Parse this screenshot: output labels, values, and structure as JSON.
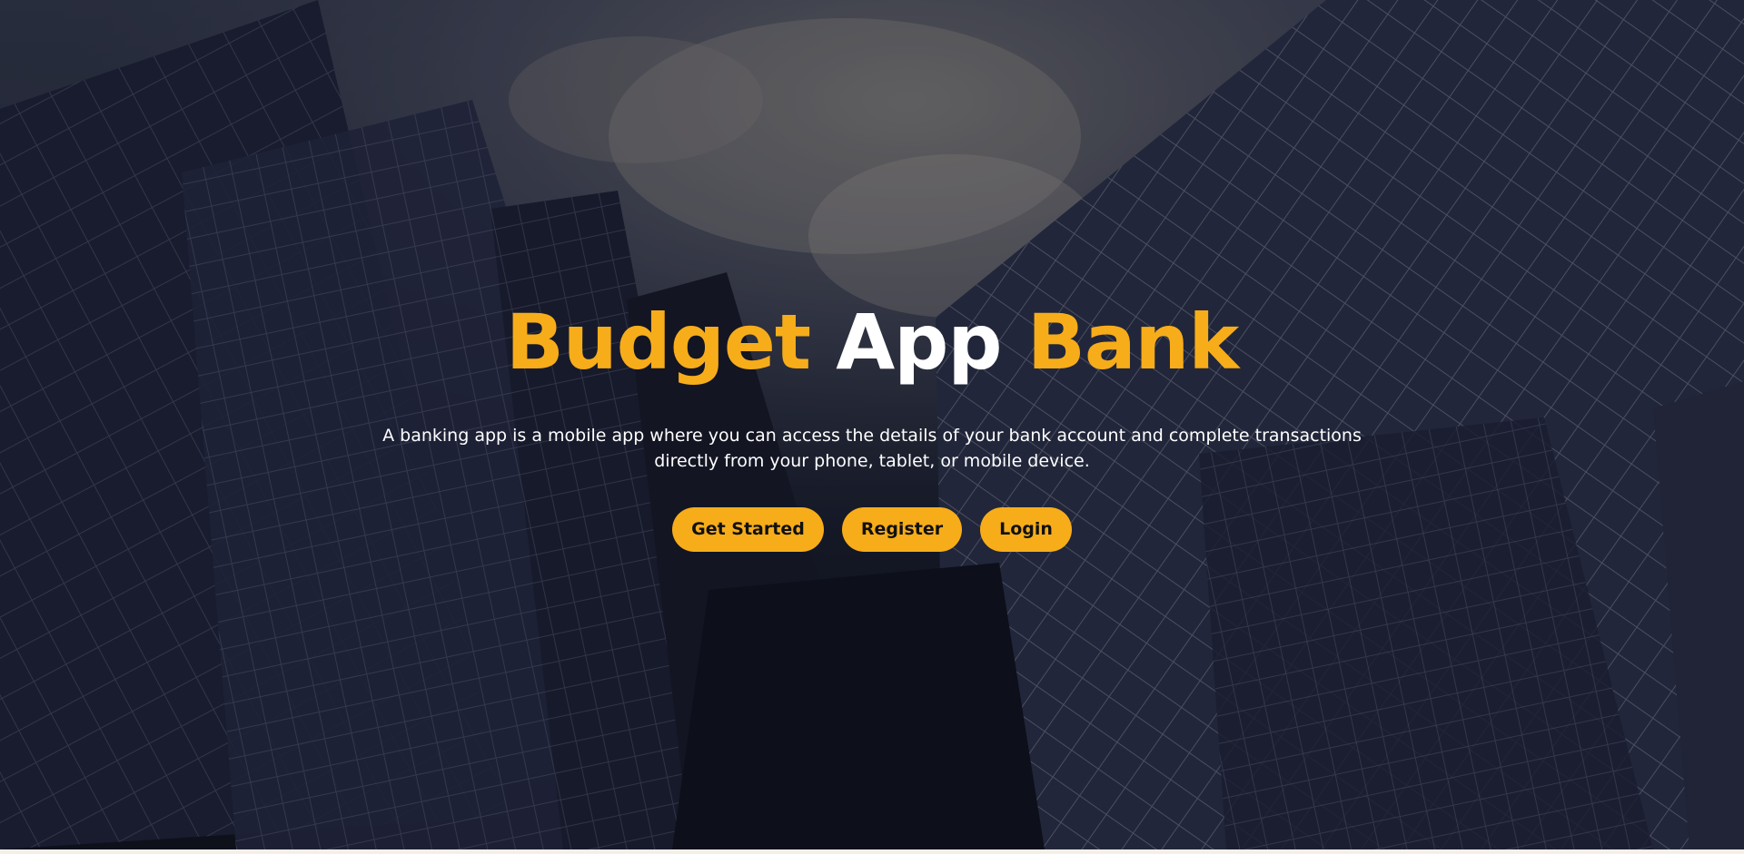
{
  "hero": {
    "title": {
      "word1": "Budget",
      "word2": "App",
      "word3": "Bank"
    },
    "description_line1": "A banking app is a mobile app where you can access the details of your bank account and complete transactions",
    "description_line2": "directly from your phone, tablet, or mobile device.",
    "buttons": {
      "get_started": "Get Started",
      "register": "Register",
      "login": "Login"
    },
    "background_image": "skyscrapers-looking-up-at-sky"
  },
  "colors": {
    "accent": "#f7ad1a",
    "title_middle": "#ffffff",
    "text": "#ffffff",
    "button_text": "#111111"
  }
}
